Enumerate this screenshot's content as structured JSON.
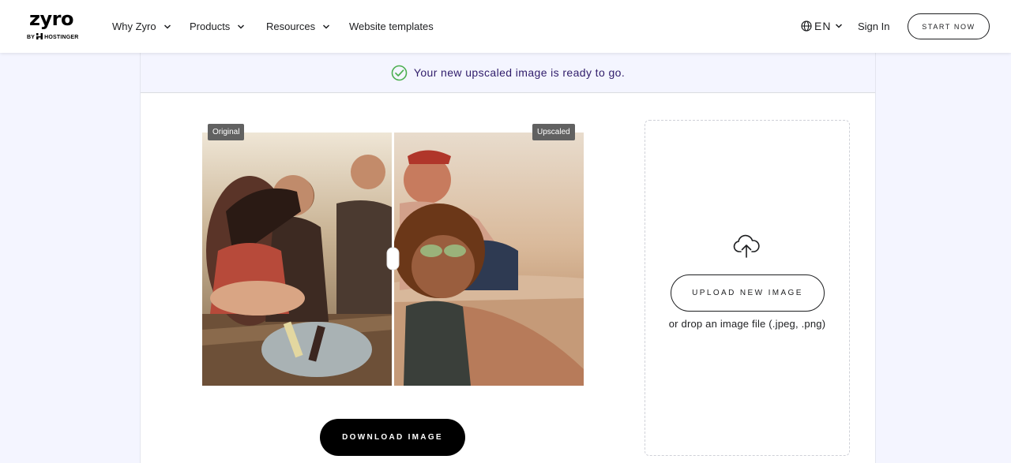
{
  "brand": {
    "logo_word": "zyro",
    "logo_sub_by": "BY",
    "logo_sub_name": "HOSTINGER"
  },
  "nav": {
    "why": "Why Zyro",
    "products": "Products",
    "resources": "Resources",
    "templates": "Website templates"
  },
  "header": {
    "language": "EN",
    "sign_in": "Sign In",
    "start_now": "START NOW"
  },
  "banner": {
    "message": "Your new upscaled image is ready to go."
  },
  "compare": {
    "original_label": "Original",
    "upscaled_label": "Upscaled",
    "download_label": "DOWNLOAD IMAGE"
  },
  "upload": {
    "button_label": "UPLOAD NEW IMAGE",
    "hint": "or drop an image file (.jpeg, .png)"
  },
  "colors": {
    "accent_green": "#4caf50",
    "banner_text": "#2f1c6a",
    "page_bg": "#f4f5ff"
  },
  "icons": [
    "globe-icon",
    "chevron-down-icon",
    "check-circle-icon",
    "cloud-upload-icon",
    "slider-handle"
  ]
}
